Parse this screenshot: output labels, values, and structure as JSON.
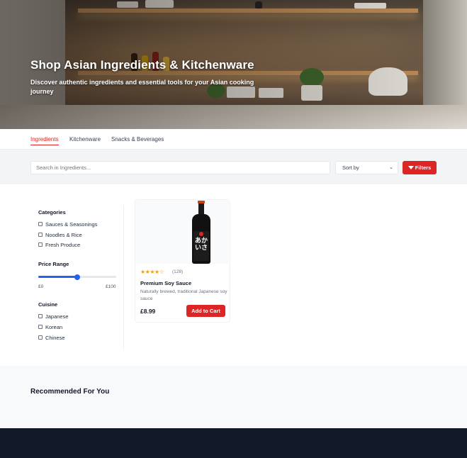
{
  "hero": {
    "title": "Shop Asian Ingredients & Kitchenware",
    "subtitle": "Discover authentic ingredients and essential tools for your Asian cooking journey"
  },
  "tabs": [
    {
      "label": "Ingredients",
      "active": true
    },
    {
      "label": "Kitchenware",
      "active": false
    },
    {
      "label": "Snacks & Beverages",
      "active": false
    }
  ],
  "search": {
    "placeholder": "Search in Ingredients..."
  },
  "sort": {
    "label": "Sort by"
  },
  "filters": {
    "label": "Filters"
  },
  "sidebar": {
    "categories_title": "Categories",
    "categories": [
      "Sauces & Seasonings",
      "Noodles & Rice",
      "Fresh Produce"
    ],
    "price_title": "Price Range",
    "price_min": "£0",
    "price_max": "£100",
    "price_value_fraction": 0.5,
    "cuisine_title": "Cuisine",
    "cuisines": [
      "Japanese",
      "Korean",
      "Chinese"
    ]
  },
  "product": {
    "rating_stars": "★★★★☆",
    "rating_value": 4,
    "reviews": "(128)",
    "name": "Premium Soy Sauce",
    "description": "Naturally brewed, traditional Japanese soy sauce",
    "price": "£8.99",
    "add_label": "Add to Cart",
    "bottle_label": "あかいさ"
  },
  "recommended": {
    "title": "Recommended For You"
  },
  "colors": {
    "accent": "#dc2626",
    "slider": "#2563eb",
    "footer": "#111827",
    "star": "#f59e0b"
  }
}
